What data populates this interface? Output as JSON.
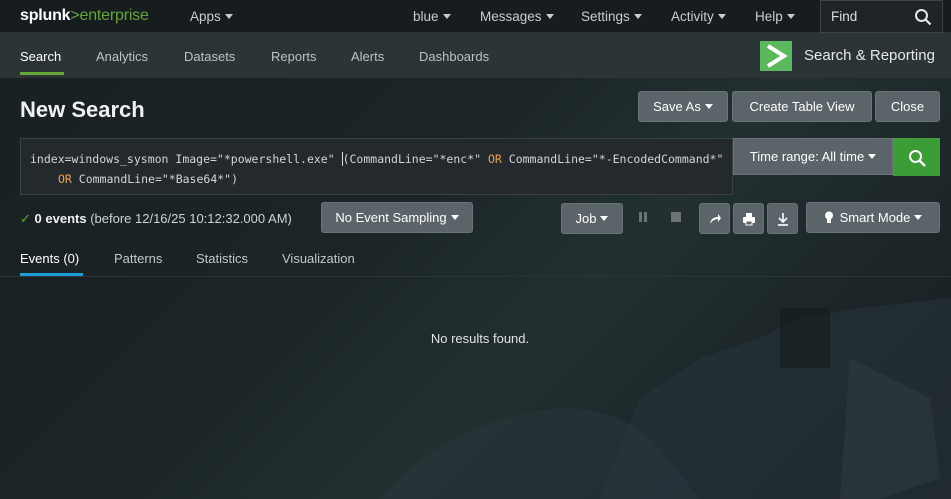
{
  "topbar": {
    "logo": {
      "part1": "splunk",
      "part2": ">",
      "part3": "enterprise"
    },
    "apps_label": "Apps",
    "user_label": "blue",
    "messages_label": "Messages",
    "settings_label": "Settings",
    "activity_label": "Activity",
    "help_label": "Help",
    "find_placeholder": "Find"
  },
  "appbar": {
    "tabs": [
      {
        "label": "Search"
      },
      {
        "label": "Analytics"
      },
      {
        "label": "Datasets"
      },
      {
        "label": "Reports"
      },
      {
        "label": "Alerts"
      },
      {
        "label": "Dashboards"
      }
    ],
    "app_title": "Search & Reporting"
  },
  "page": {
    "title": "New Search",
    "save_as_label": "Save As",
    "create_table_view_label": "Create Table View",
    "close_label": "Close"
  },
  "search": {
    "query_parts": {
      "p1": "index=windows_sysmon Image=\"*powershell.exe\" ",
      "p2": "(",
      "p3": "CommandLine=\"*enc*\" ",
      "op1": "OR",
      "p4": " CommandLine=\"*-EncodedCommand*\"",
      "op2": "OR",
      "p5": " CommandLine=\"*Base64*\")"
    },
    "time_range_label": "Time range: All time"
  },
  "status": {
    "count_label": "0 events",
    "detail": "(before 12/16/25 10:12:32.000 AM)",
    "sampling_label": "No Event Sampling",
    "job_label": "Job",
    "mode_label": "Smart Mode"
  },
  "results_tabs": [
    {
      "label": "Events (0)"
    },
    {
      "label": "Patterns"
    },
    {
      "label": "Statistics"
    },
    {
      "label": "Visualization"
    }
  ],
  "results": {
    "empty_message": "No results found."
  },
  "colors": {
    "brand_green": "#65a637",
    "go_button": "#3c9c35",
    "tab_active_underline": "#1a9fd7",
    "query_operator": "#e8a34c"
  }
}
